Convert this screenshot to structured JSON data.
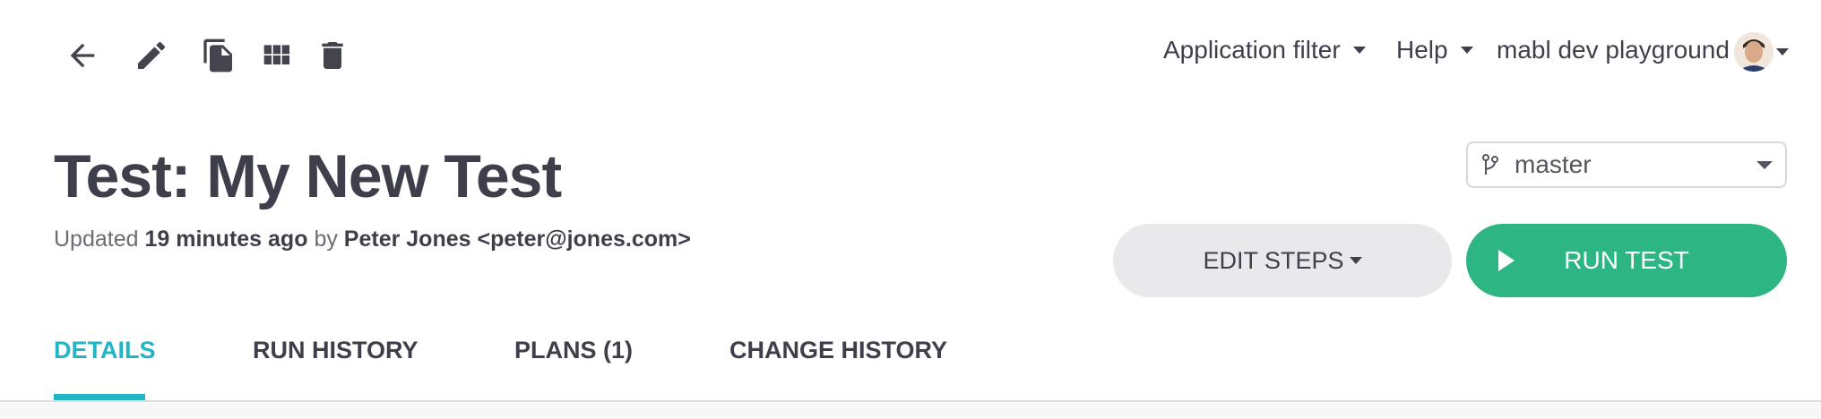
{
  "toolbar": {
    "icons": [
      "back-arrow-icon",
      "pencil-edit-icon",
      "duplicate-icon",
      "grid-icon",
      "trash-icon"
    ]
  },
  "topnav": {
    "application_filter": "Application filter",
    "help": "Help",
    "workspace": "mabl dev playground"
  },
  "test": {
    "title": "Test: My New Test",
    "updated_prefix": "Updated",
    "updated_time": "19 minutes ago",
    "by": "by",
    "author": "Peter Jones <peter@jones.com>"
  },
  "branch": {
    "selected": "master"
  },
  "actions": {
    "edit_steps": "EDIT STEPS",
    "run_test": "RUN TEST"
  },
  "tabs": [
    {
      "label": "DETAILS",
      "active": true
    },
    {
      "label": "RUN HISTORY",
      "active": false
    },
    {
      "label": "PLANS (1)",
      "active": false
    },
    {
      "label": "CHANGE HISTORY",
      "active": false
    }
  ],
  "colors": {
    "primary_green": "#2db683",
    "active_tab": "#22b6c4",
    "text_dark": "#3f3f4b"
  }
}
